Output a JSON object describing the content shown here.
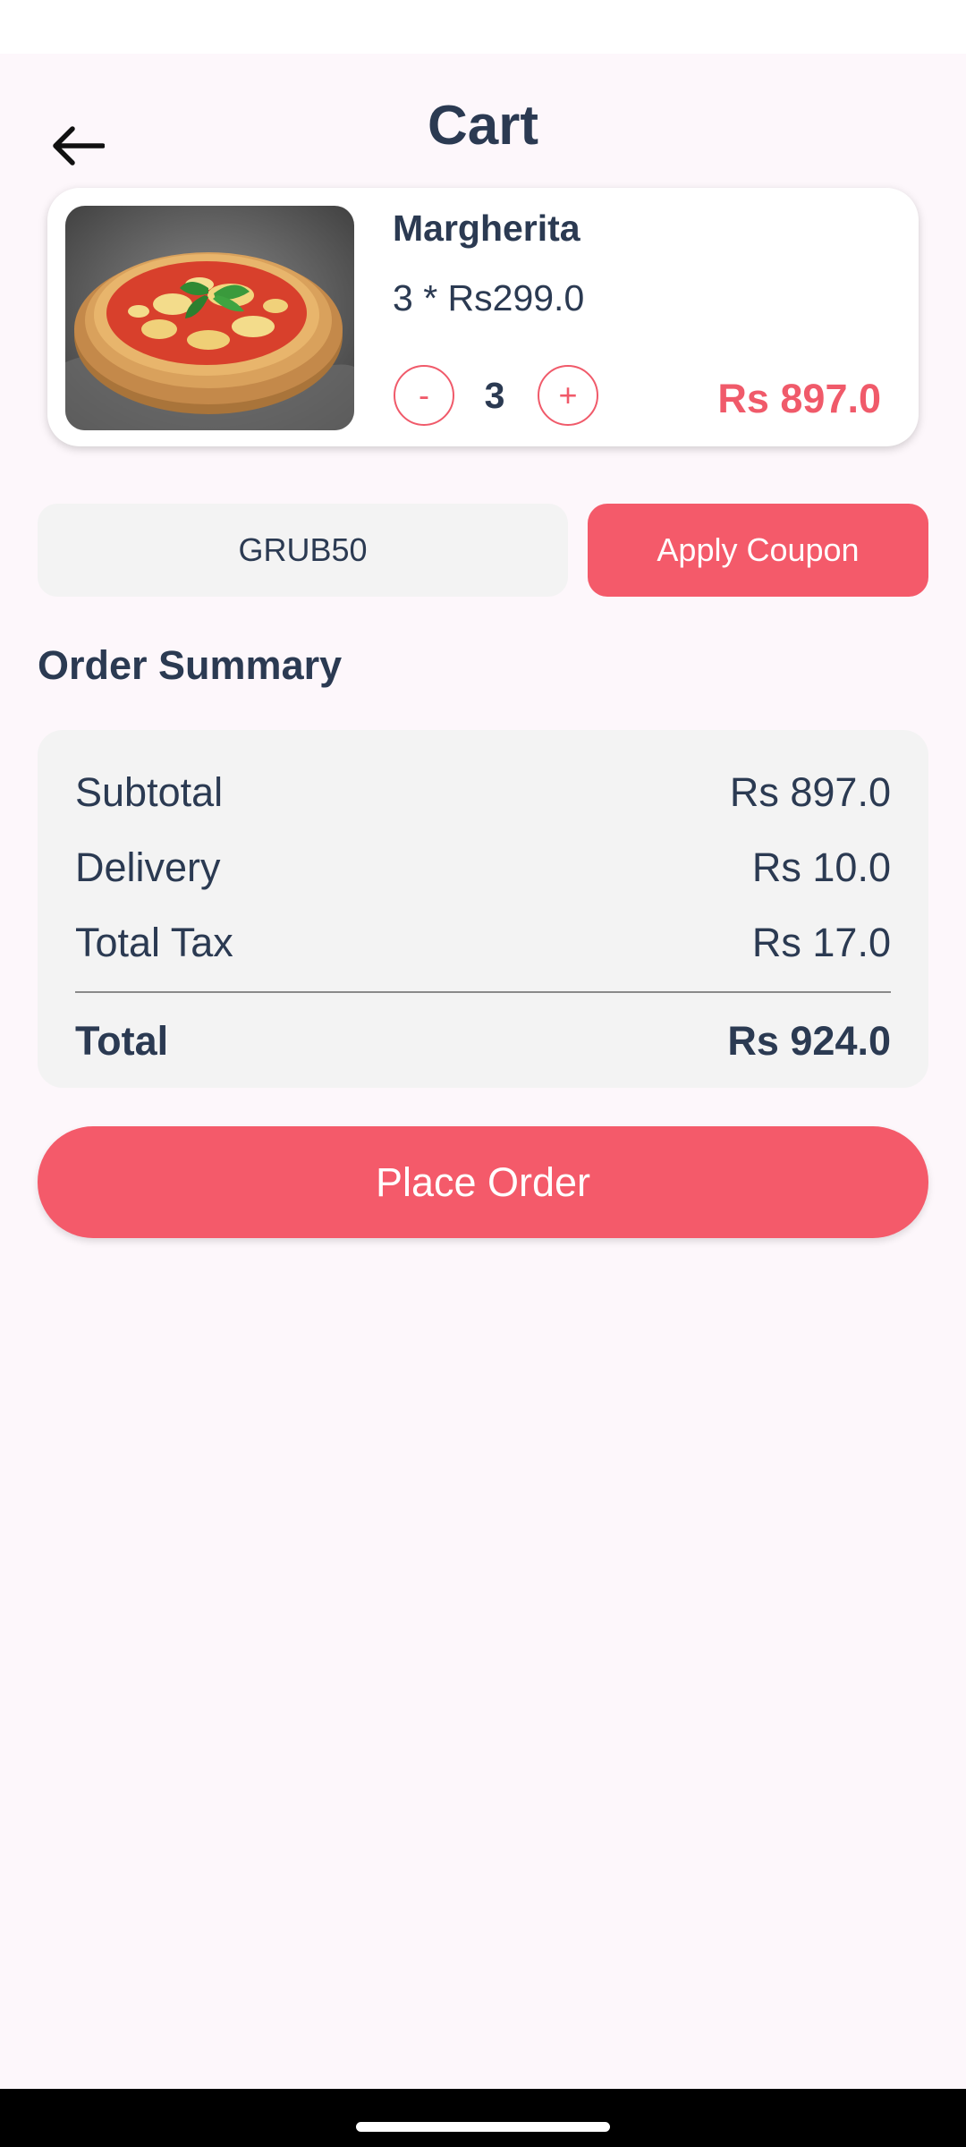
{
  "header": {
    "title": "Cart",
    "back_icon": "arrow-left-icon"
  },
  "cart_item": {
    "image_icon": "pizza-image",
    "name": "Margherita",
    "unit_price_text": "3 * Rs299.0",
    "decrement_label": "-",
    "quantity": "3",
    "increment_label": "+",
    "item_total": "Rs 897.0"
  },
  "coupon": {
    "value": "GRUB50",
    "apply_label": "Apply Coupon"
  },
  "order_summary": {
    "title": "Order Summary",
    "subtotal_label": "Subtotal",
    "subtotal_value": "Rs 897.0",
    "delivery_label": "Delivery",
    "delivery_value": "Rs 10.0",
    "tax_label": "Total Tax",
    "tax_value": "Rs 17.0",
    "total_label": "Total",
    "total_value": "Rs 924.0"
  },
  "actions": {
    "place_order_label": "Place Order"
  },
  "colors": {
    "accent": "#f45a6a",
    "text": "#2b3a52",
    "background": "#fdf7fb"
  }
}
